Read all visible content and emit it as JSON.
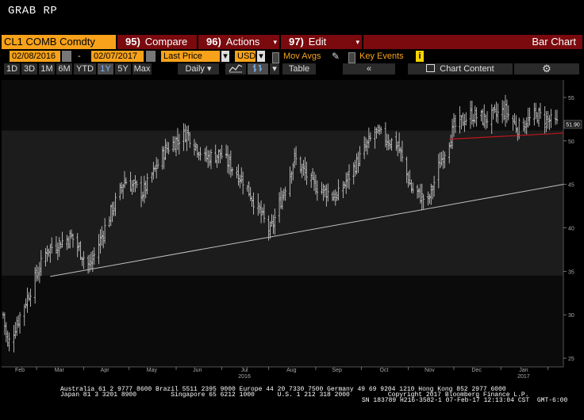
{
  "window": {
    "title": "GRAB RP"
  },
  "toolbar1": {
    "ticker": "CL1 COMB Comdty",
    "compare": {
      "num": "95)",
      "label": "Compare"
    },
    "actions": {
      "num": "96)",
      "label": "Actions"
    },
    "edit": {
      "num": "97)",
      "label": "Edit"
    },
    "chart_type": "Bar Chart"
  },
  "toolbar2": {
    "start_date": "02/08/2016",
    "separator": "-",
    "end_date": "02/07/2017",
    "field": "Last Price",
    "currency": "USD",
    "mov_avgs": "Mov Avgs",
    "key_events": "Key Events",
    "info": "i"
  },
  "toolbar3": {
    "periods": [
      "1D",
      "3D",
      "1M",
      "6M",
      "YTD",
      "1Y",
      "5Y",
      "Max"
    ],
    "selected_period": "1Y",
    "frequency": "Daily",
    "table": "Table",
    "nav_back": "«",
    "chart_content": "Chart Content",
    "settings_icon": "gear-icon"
  },
  "chart_data": {
    "type": "bar",
    "x_month_labels": [
      "Feb",
      "Mar",
      "Apr",
      "May",
      "Jun",
      "Jul",
      "Aug",
      "Sep",
      "Oct",
      "Nov",
      "Dec",
      "Jan"
    ],
    "x_year_labels": [
      "2016",
      "2017"
    ],
    "y_ticks": [
      25,
      30,
      35,
      40,
      45,
      50,
      55
    ],
    "ylim": [
      24,
      57
    ],
    "last_price_label": "51.90",
    "colors": {
      "bars": "#d8d8d8",
      "trend_support": "#bfbfbf",
      "trend_recent": "#c0161b",
      "band_shade": "#1c1c1c",
      "background": "#0b0b0b"
    },
    "anchors": [
      {
        "d": "2016-02-08",
        "p": 30.0
      },
      {
        "d": "2016-02-11",
        "p": 26.5
      },
      {
        "d": "2016-02-24",
        "p": 32.0
      },
      {
        "d": "2016-03-08",
        "p": 37.5
      },
      {
        "d": "2016-03-24",
        "p": 39.0
      },
      {
        "d": "2016-04-05",
        "p": 35.5
      },
      {
        "d": "2016-04-15",
        "p": 40.0
      },
      {
        "d": "2016-04-28",
        "p": 45.5
      },
      {
        "d": "2016-05-10",
        "p": 44.0
      },
      {
        "d": "2016-05-25",
        "p": 49.0
      },
      {
        "d": "2016-06-08",
        "p": 51.0
      },
      {
        "d": "2016-06-20",
        "p": 48.0
      },
      {
        "d": "2016-06-30",
        "p": 48.5
      },
      {
        "d": "2016-07-15",
        "p": 45.5
      },
      {
        "d": "2016-08-02",
        "p": 39.5
      },
      {
        "d": "2016-08-18",
        "p": 48.0
      },
      {
        "d": "2016-08-30",
        "p": 45.0
      },
      {
        "d": "2016-09-15",
        "p": 43.5
      },
      {
        "d": "2016-09-28",
        "p": 47.5
      },
      {
        "d": "2016-10-10",
        "p": 51.0
      },
      {
        "d": "2016-10-25",
        "p": 49.5
      },
      {
        "d": "2016-11-03",
        "p": 44.5
      },
      {
        "d": "2016-11-14",
        "p": 43.0
      },
      {
        "d": "2016-11-22",
        "p": 47.5
      },
      {
        "d": "2016-12-01",
        "p": 51.5
      },
      {
        "d": "2016-12-12",
        "p": 53.0
      },
      {
        "d": "2016-12-22",
        "p": 52.5
      },
      {
        "d": "2017-01-04",
        "p": 53.5
      },
      {
        "d": "2017-01-12",
        "p": 51.5
      },
      {
        "d": "2017-01-25",
        "p": 53.0
      },
      {
        "d": "2017-02-07",
        "p": 51.9
      }
    ]
  },
  "footer": {
    "line1": "Australia 61 2 9777 8600 Brazil 5511 2395 9000 Europe 44 20 7330 7500 Germany 49 69 9204 1210 Hong Kong 852 2977 6000",
    "line2": "Japan 81 3 3201 8900         Singapore 65 6212 1000      U.S. 1 212 318 2000          Copyright 2017 Bloomberg Finance L.P.",
    "line3": "SN 183789 H216-3582-1 07-Feb-17 12:13:04 CST  GMT-6:00"
  }
}
